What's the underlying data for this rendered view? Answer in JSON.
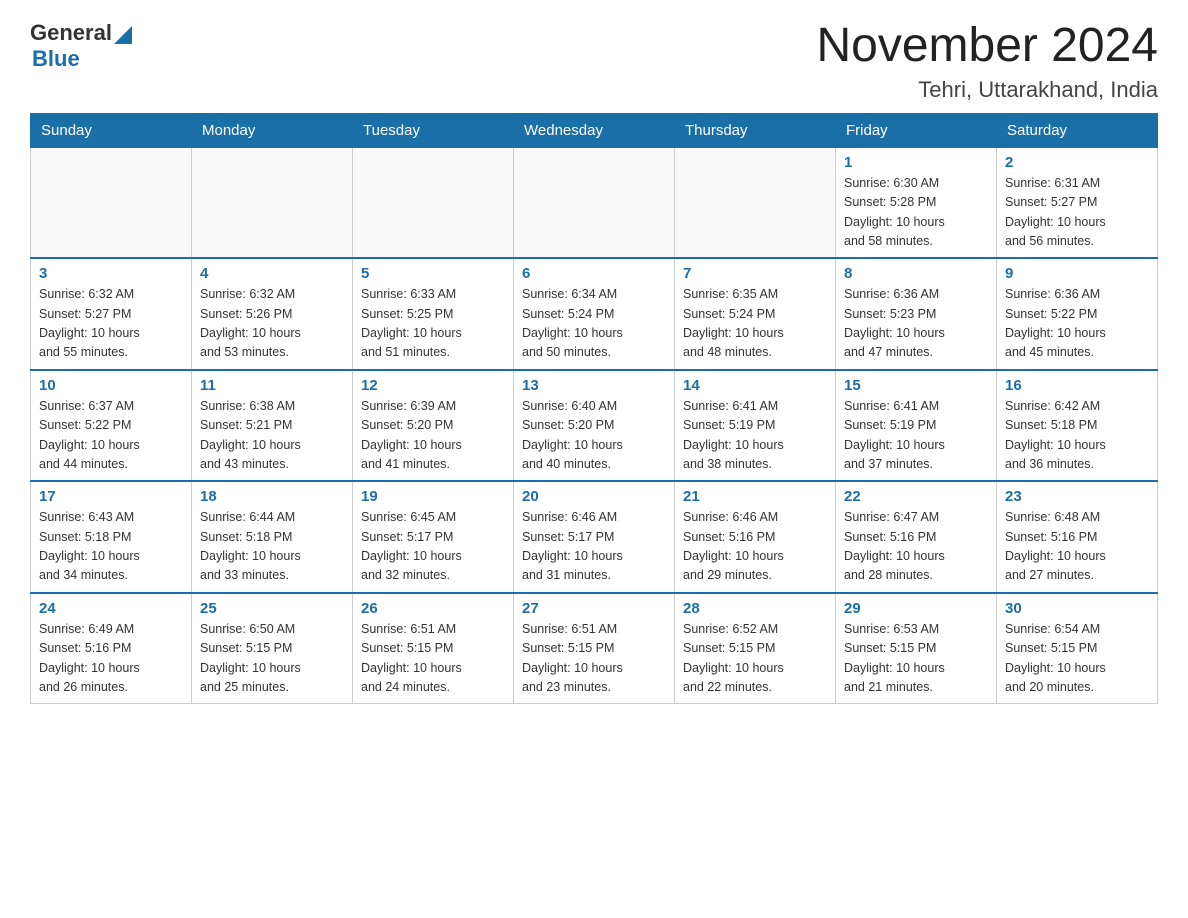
{
  "header": {
    "logo_general": "General",
    "logo_blue": "Blue",
    "month_title": "November 2024",
    "location": "Tehri, Uttarakhand, India"
  },
  "weekdays": [
    "Sunday",
    "Monday",
    "Tuesday",
    "Wednesday",
    "Thursday",
    "Friday",
    "Saturday"
  ],
  "weeks": [
    [
      {
        "day": "",
        "info": ""
      },
      {
        "day": "",
        "info": ""
      },
      {
        "day": "",
        "info": ""
      },
      {
        "day": "",
        "info": ""
      },
      {
        "day": "",
        "info": ""
      },
      {
        "day": "1",
        "info": "Sunrise: 6:30 AM\nSunset: 5:28 PM\nDaylight: 10 hours\nand 58 minutes."
      },
      {
        "day": "2",
        "info": "Sunrise: 6:31 AM\nSunset: 5:27 PM\nDaylight: 10 hours\nand 56 minutes."
      }
    ],
    [
      {
        "day": "3",
        "info": "Sunrise: 6:32 AM\nSunset: 5:27 PM\nDaylight: 10 hours\nand 55 minutes."
      },
      {
        "day": "4",
        "info": "Sunrise: 6:32 AM\nSunset: 5:26 PM\nDaylight: 10 hours\nand 53 minutes."
      },
      {
        "day": "5",
        "info": "Sunrise: 6:33 AM\nSunset: 5:25 PM\nDaylight: 10 hours\nand 51 minutes."
      },
      {
        "day": "6",
        "info": "Sunrise: 6:34 AM\nSunset: 5:24 PM\nDaylight: 10 hours\nand 50 minutes."
      },
      {
        "day": "7",
        "info": "Sunrise: 6:35 AM\nSunset: 5:24 PM\nDaylight: 10 hours\nand 48 minutes."
      },
      {
        "day": "8",
        "info": "Sunrise: 6:36 AM\nSunset: 5:23 PM\nDaylight: 10 hours\nand 47 minutes."
      },
      {
        "day": "9",
        "info": "Sunrise: 6:36 AM\nSunset: 5:22 PM\nDaylight: 10 hours\nand 45 minutes."
      }
    ],
    [
      {
        "day": "10",
        "info": "Sunrise: 6:37 AM\nSunset: 5:22 PM\nDaylight: 10 hours\nand 44 minutes."
      },
      {
        "day": "11",
        "info": "Sunrise: 6:38 AM\nSunset: 5:21 PM\nDaylight: 10 hours\nand 43 minutes."
      },
      {
        "day": "12",
        "info": "Sunrise: 6:39 AM\nSunset: 5:20 PM\nDaylight: 10 hours\nand 41 minutes."
      },
      {
        "day": "13",
        "info": "Sunrise: 6:40 AM\nSunset: 5:20 PM\nDaylight: 10 hours\nand 40 minutes."
      },
      {
        "day": "14",
        "info": "Sunrise: 6:41 AM\nSunset: 5:19 PM\nDaylight: 10 hours\nand 38 minutes."
      },
      {
        "day": "15",
        "info": "Sunrise: 6:41 AM\nSunset: 5:19 PM\nDaylight: 10 hours\nand 37 minutes."
      },
      {
        "day": "16",
        "info": "Sunrise: 6:42 AM\nSunset: 5:18 PM\nDaylight: 10 hours\nand 36 minutes."
      }
    ],
    [
      {
        "day": "17",
        "info": "Sunrise: 6:43 AM\nSunset: 5:18 PM\nDaylight: 10 hours\nand 34 minutes."
      },
      {
        "day": "18",
        "info": "Sunrise: 6:44 AM\nSunset: 5:18 PM\nDaylight: 10 hours\nand 33 minutes."
      },
      {
        "day": "19",
        "info": "Sunrise: 6:45 AM\nSunset: 5:17 PM\nDaylight: 10 hours\nand 32 minutes."
      },
      {
        "day": "20",
        "info": "Sunrise: 6:46 AM\nSunset: 5:17 PM\nDaylight: 10 hours\nand 31 minutes."
      },
      {
        "day": "21",
        "info": "Sunrise: 6:46 AM\nSunset: 5:16 PM\nDaylight: 10 hours\nand 29 minutes."
      },
      {
        "day": "22",
        "info": "Sunrise: 6:47 AM\nSunset: 5:16 PM\nDaylight: 10 hours\nand 28 minutes."
      },
      {
        "day": "23",
        "info": "Sunrise: 6:48 AM\nSunset: 5:16 PM\nDaylight: 10 hours\nand 27 minutes."
      }
    ],
    [
      {
        "day": "24",
        "info": "Sunrise: 6:49 AM\nSunset: 5:16 PM\nDaylight: 10 hours\nand 26 minutes."
      },
      {
        "day": "25",
        "info": "Sunrise: 6:50 AM\nSunset: 5:15 PM\nDaylight: 10 hours\nand 25 minutes."
      },
      {
        "day": "26",
        "info": "Sunrise: 6:51 AM\nSunset: 5:15 PM\nDaylight: 10 hours\nand 24 minutes."
      },
      {
        "day": "27",
        "info": "Sunrise: 6:51 AM\nSunset: 5:15 PM\nDaylight: 10 hours\nand 23 minutes."
      },
      {
        "day": "28",
        "info": "Sunrise: 6:52 AM\nSunset: 5:15 PM\nDaylight: 10 hours\nand 22 minutes."
      },
      {
        "day": "29",
        "info": "Sunrise: 6:53 AM\nSunset: 5:15 PM\nDaylight: 10 hours\nand 21 minutes."
      },
      {
        "day": "30",
        "info": "Sunrise: 6:54 AM\nSunset: 5:15 PM\nDaylight: 10 hours\nand 20 minutes."
      }
    ]
  ]
}
